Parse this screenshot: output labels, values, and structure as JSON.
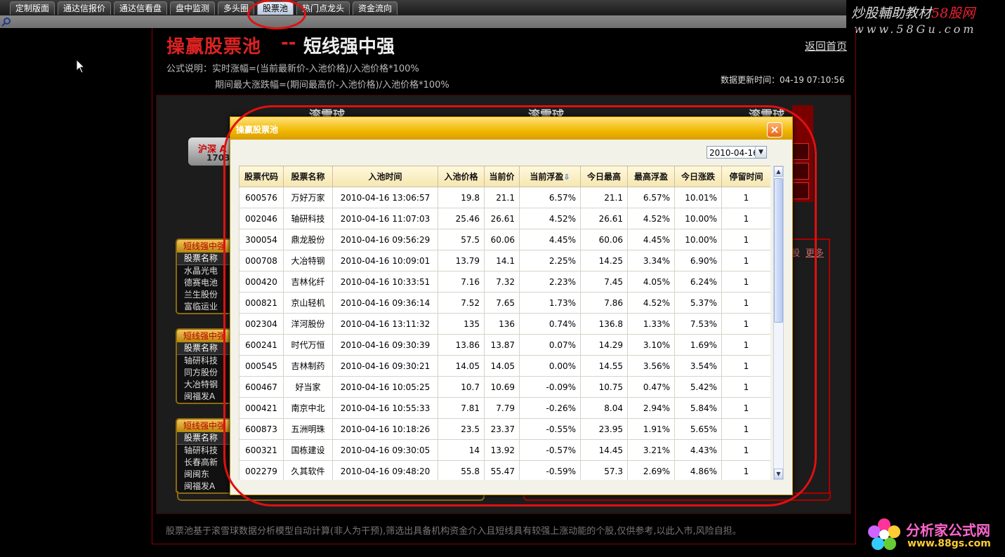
{
  "tabs": [
    "定制版面",
    "通达信报价",
    "通达信看盘",
    "盘中监测",
    "多头圈",
    "股票池",
    "热门点龙头",
    "资金流向"
  ],
  "watermark": {
    "line1_a": "炒股輔助教材",
    "line1_b": "58股网",
    "line2": "www.58Gu.com"
  },
  "logo": {
    "name": "分析家公式网",
    "url": "www.88gs.com"
  },
  "header": {
    "title_main": "操赢股票池",
    "title_dash": "--",
    "title_sub": "短线强中强",
    "back_link": "返回首页",
    "formula_line1": "公式说明：实时涨幅=(当前最新价-入池价格)/入池价格*100%",
    "formula_line2": "期间最大涨跌幅=(期间最高价-入池价格)/入池价格*100%",
    "update_time": "数据更新时间：04-19 07:10:56"
  },
  "background": {
    "snowball_label": "滚雪球",
    "market_box_title": "沪深 A",
    "market_box_number": "1703",
    "more_text": "股",
    "more_link": "更多"
  },
  "panels": [
    {
      "title": "短线强中强",
      "column": "股票名称",
      "items": [
        "水晶光电",
        "德赛电池",
        "兰生股份",
        "富临运业"
      ]
    },
    {
      "title": "短线强中强",
      "column": "股票名称",
      "items": [
        "轴研科技",
        "同方股份",
        "大冶特钢",
        "闽福发A"
      ]
    },
    {
      "title": "短线强中强",
      "column": "股票名称",
      "items": [
        "轴研科技",
        "长春高新",
        "闽闽东",
        "闽福发A"
      ]
    }
  ],
  "footer_note": "股票池基于滚雪球数据分析模型自动计算(非人为干预),筛选出具备机构资金介入且短线具有较强上涨动能的个股,仅供参考,以此入市,风险自担。",
  "modal": {
    "title": "操赢股票池",
    "close_glyph": "×",
    "date_value": "2010-04-16",
    "date_arrow": "▼",
    "columns": [
      "股票代码",
      "股票名称",
      "入池时间",
      "入池价格",
      "当前价",
      "当前浮盈",
      "今日最高",
      "最高浮盈",
      "今日涨跌",
      "停留时间"
    ],
    "sort_indicator": "⇩",
    "rows": [
      [
        "600576",
        "万好万家",
        "2010-04-16 13:06:57",
        "19.8",
        "21.1",
        "6.57%",
        "21.1",
        "6.57%",
        "10.01%",
        "1"
      ],
      [
        "002046",
        "轴研科技",
        "2010-04-16 11:07:03",
        "25.46",
        "26.61",
        "4.52%",
        "26.61",
        "4.52%",
        "10.00%",
        "1"
      ],
      [
        "300054",
        "鼎龙股份",
        "2010-04-16 09:56:29",
        "57.5",
        "60.06",
        "4.45%",
        "60.06",
        "4.45%",
        "10.00%",
        "1"
      ],
      [
        "000708",
        "大冶特钢",
        "2010-04-16 10:09:01",
        "13.79",
        "14.1",
        "2.25%",
        "14.25",
        "3.34%",
        "6.90%",
        "1"
      ],
      [
        "000420",
        "吉林化纤",
        "2010-04-16 10:33:51",
        "7.16",
        "7.32",
        "2.23%",
        "7.45",
        "4.05%",
        "6.24%",
        "1"
      ],
      [
        "000821",
        "京山轻机",
        "2010-04-16 09:36:14",
        "7.52",
        "7.65",
        "1.73%",
        "7.86",
        "4.52%",
        "5.37%",
        "1"
      ],
      [
        "002304",
        "洋河股份",
        "2010-04-16 13:11:32",
        "135",
        "136",
        "0.74%",
        "136.8",
        "1.33%",
        "7.53%",
        "1"
      ],
      [
        "600241",
        "时代万恒",
        "2010-04-16 09:30:39",
        "13.86",
        "13.87",
        "0.07%",
        "14.29",
        "3.10%",
        "1.69%",
        "1"
      ],
      [
        "000545",
        "吉林制药",
        "2010-04-16 09:30:21",
        "14.05",
        "14.05",
        "0.00%",
        "14.55",
        "3.56%",
        "3.54%",
        "1"
      ],
      [
        "600467",
        "好当家",
        "2010-04-16 10:05:25",
        "10.7",
        "10.69",
        "-0.09%",
        "10.75",
        "0.47%",
        "5.42%",
        "1"
      ],
      [
        "000421",
        "南京中北",
        "2010-04-16 10:55:33",
        "7.81",
        "7.79",
        "-0.26%",
        "8.04",
        "2.94%",
        "5.84%",
        "1"
      ],
      [
        "600873",
        "五洲明珠",
        "2010-04-16 10:18:26",
        "23.5",
        "23.37",
        "-0.55%",
        "23.95",
        "1.91%",
        "5.65%",
        "1"
      ],
      [
        "600321",
        "国栋建设",
        "2010-04-16 09:30:05",
        "14",
        "13.92",
        "-0.57%",
        "14.45",
        "3.21%",
        "4.43%",
        "1"
      ],
      [
        "002279",
        "久其软件",
        "2010-04-16 09:48:20",
        "55.8",
        "55.47",
        "-0.59%",
        "57.3",
        "2.69%",
        "4.86%",
        "1"
      ]
    ]
  },
  "colors": {
    "accent_red": "#d22222",
    "modal_title": "#f1b800",
    "annotation": "#e01010"
  }
}
